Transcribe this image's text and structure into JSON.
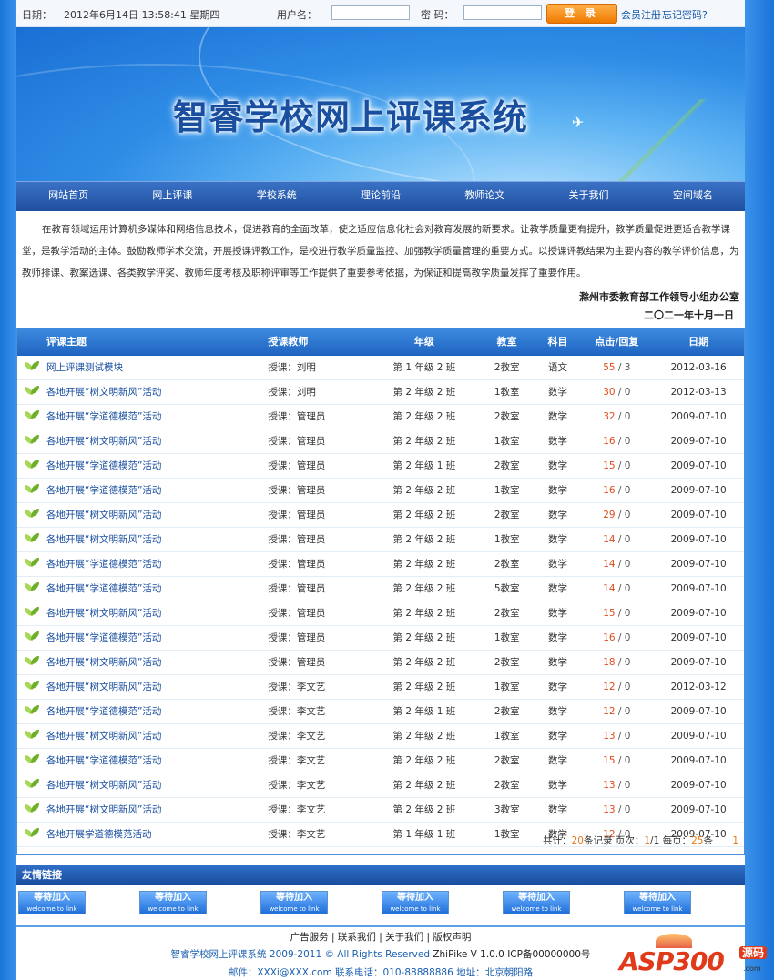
{
  "topbar": {
    "date_label": "日期：",
    "datetime": "2012年6月14日 13:58:41 星期四",
    "username_label": "用户名：",
    "username_value": "",
    "password_label": "密  码：",
    "password_value": "",
    "login_button": "登 录",
    "register_link": "会员注册",
    "forgot_link": "忘记密码?"
  },
  "banner": {
    "title": "智睿学校网上评课系统"
  },
  "nav": {
    "items": [
      "网站首页",
      "网上评课",
      "学校系统",
      "理论前沿",
      "教师论文",
      "关于我们",
      "空间域名"
    ]
  },
  "intro": {
    "text": "在教育领域运用计算机多媒体和网络信息技术，促进教育的全面改革，使之适应信息化社会对教育发展的新要求。让教学质量更有提升，教学质量促进更适合教学课堂，是教学活动的主体。鼓励教师学术交流，开展授课评教工作，是校进行教学质量监控、加强教学质量管理的重要方式。以授课评教结果为主要内容的教学评价信息，为教师排课、教案选课、各类教学评奖、教师年度考核及职称评审等工作提供了重要参考依据，为保证和提高教学质量发挥了重要作用。",
    "signature_org": "滁州市委教育部工作领导小组办公室",
    "signature_date": "二〇二一年十月一日"
  },
  "table": {
    "headers": {
      "topic": "评课主题",
      "teacher": "授课教师",
      "grade": "年级",
      "room": "教室",
      "subject": "科目",
      "clicks": "点击/回复",
      "date": "日期"
    },
    "rows": [
      {
        "topic": "网上评课测试模块",
        "teacher": "授课：刘明",
        "grade": "第 1 年级 2 班",
        "room": "2教室",
        "subject": "语文",
        "clicks": "55",
        "replies": " / 3",
        "date": "2012-03-16"
      },
      {
        "topic": "各地开展“树文明新风”活动",
        "teacher": "授课：刘明",
        "grade": "第 2 年级 2 班",
        "room": "1教室",
        "subject": "数学",
        "clicks": "30",
        "replies": " / 0",
        "date": "2012-03-13"
      },
      {
        "topic": "各地开展“学道德模范”活动",
        "teacher": "授课：管理员",
        "grade": "第 2 年级 2 班",
        "room": "2教室",
        "subject": "数学",
        "clicks": "32",
        "replies": " / 0",
        "date": "2009-07-10"
      },
      {
        "topic": "各地开展“树文明新风”活动",
        "teacher": "授课：管理员",
        "grade": "第 2 年级 2 班",
        "room": "1教室",
        "subject": "数学",
        "clicks": "16",
        "replies": " / 0",
        "date": "2009-07-10"
      },
      {
        "topic": "各地开展“学道德模范”活动",
        "teacher": "授课：管理员",
        "grade": "第 2 年级 1 班",
        "room": "2教室",
        "subject": "数学",
        "clicks": "15",
        "replies": " / 0",
        "date": "2009-07-10"
      },
      {
        "topic": "各地开展“学道德模范”活动",
        "teacher": "授课：管理员",
        "grade": "第 2 年级 2 班",
        "room": "1教室",
        "subject": "数学",
        "clicks": "16",
        "replies": " / 0",
        "date": "2009-07-10"
      },
      {
        "topic": "各地开展“树文明新风”活动",
        "teacher": "授课：管理员",
        "grade": "第 2 年级 2 班",
        "room": "2教室",
        "subject": "数学",
        "clicks": "29",
        "replies": " / 0",
        "date": "2009-07-10"
      },
      {
        "topic": "各地开展“树文明新风”活动",
        "teacher": "授课：管理员",
        "grade": "第 2 年级 2 班",
        "room": "1教室",
        "subject": "数学",
        "clicks": "14",
        "replies": " / 0",
        "date": "2009-07-10"
      },
      {
        "topic": "各地开展“学道德模范”活动",
        "teacher": "授课：管理员",
        "grade": "第 2 年级 2 班",
        "room": "2教室",
        "subject": "数学",
        "clicks": "14",
        "replies": " / 0",
        "date": "2009-07-10"
      },
      {
        "topic": "各地开展“学道德模范”活动",
        "teacher": "授课：管理员",
        "grade": "第 2 年级 2 班",
        "room": "5教室",
        "subject": "数学",
        "clicks": "14",
        "replies": " / 0",
        "date": "2009-07-10"
      },
      {
        "topic": "各地开展“树文明新风”活动",
        "teacher": "授课：管理员",
        "grade": "第 2 年级 2 班",
        "room": "2教室",
        "subject": "数学",
        "clicks": "15",
        "replies": " / 0",
        "date": "2009-07-10"
      },
      {
        "topic": "各地开展“学道德模范”活动",
        "teacher": "授课：管理员",
        "grade": "第 2 年级 2 班",
        "room": "1教室",
        "subject": "数学",
        "clicks": "16",
        "replies": " / 0",
        "date": "2009-07-10"
      },
      {
        "topic": "各地开展“树文明新风”活动",
        "teacher": "授课：管理员",
        "grade": "第 2 年级 2 班",
        "room": "2教室",
        "subject": "数学",
        "clicks": "18",
        "replies": " / 0",
        "date": "2009-07-10"
      },
      {
        "topic": "各地开展“树文明新风”活动",
        "teacher": "授课：李文艺",
        "grade": "第 2 年级 2 班",
        "room": "1教室",
        "subject": "数学",
        "clicks": "12",
        "replies": " / 0",
        "date": "2012-03-12"
      },
      {
        "topic": "各地开展“学道德模范”活动",
        "teacher": "授课：李文艺",
        "grade": "第 2 年级 1 班",
        "room": "2教室",
        "subject": "数学",
        "clicks": "12",
        "replies": " / 0",
        "date": "2009-07-10"
      },
      {
        "topic": "各地开展“树文明新风”活动",
        "teacher": "授课：李文艺",
        "grade": "第 2 年级 2 班",
        "room": "1教室",
        "subject": "数学",
        "clicks": "13",
        "replies": " / 0",
        "date": "2009-07-10"
      },
      {
        "topic": "各地开展“学道德模范”活动",
        "teacher": "授课：李文艺",
        "grade": "第 2 年级 2 班",
        "room": "2教室",
        "subject": "数学",
        "clicks": "15",
        "replies": " / 0",
        "date": "2009-07-10"
      },
      {
        "topic": "各地开展“树文明新风”活动",
        "teacher": "授课：李文艺",
        "grade": "第 2 年级 2 班",
        "room": "2教室",
        "subject": "数学",
        "clicks": "13",
        "replies": " / 0",
        "date": "2009-07-10"
      },
      {
        "topic": "各地开展“树文明新风”活动",
        "teacher": "授课：李文艺",
        "grade": "第 2 年级 2 班",
        "room": "3教室",
        "subject": "数学",
        "clicks": "13",
        "replies": " / 0",
        "date": "2009-07-10"
      },
      {
        "topic": "各地开展学道德模范活动",
        "teacher": "授课：李文艺",
        "grade": "第 1 年级 1 班",
        "room": "1教室",
        "subject": "数学",
        "clicks": "12",
        "replies": " / 0",
        "date": "2009-07-10"
      }
    ],
    "pager": {
      "total_prefix": "共计：",
      "total": "20",
      "total_suffix": "条记录 页次：",
      "page": "1",
      "pages": "/1",
      "per_page_prefix": " 每页：",
      "per_page": "25",
      "per_page_suffix": "条",
      "page_link": "1"
    }
  },
  "friend_links": {
    "title": "友情链接",
    "items": [
      {
        "label": "等待加入",
        "sub": "welcome to link"
      },
      {
        "label": "等待加入",
        "sub": "welcome to link"
      },
      {
        "label": "等待加入",
        "sub": "welcome to link"
      },
      {
        "label": "等待加入",
        "sub": "welcome to link"
      },
      {
        "label": "等待加入",
        "sub": "welcome to link"
      },
      {
        "label": "等待加入",
        "sub": "welcome to link"
      }
    ]
  },
  "footer": {
    "links": [
      "广告服务",
      "联系我们",
      "关于我们",
      "版权声明"
    ],
    "separator": " | ",
    "copyright": "智睿学校网上评课系统 2009-2011 © All Rights Reserved",
    "version": " ZhiPike V 1.0.0 ",
    "icp": "ICP备00000000号",
    "contact": "邮件：XXXi@XXX.com 联系电话：010-88888886    地址：北京朝阳路"
  },
  "watermark": {
    "brand": "ASP300",
    "badge": "源码",
    "domain": ".com"
  }
}
